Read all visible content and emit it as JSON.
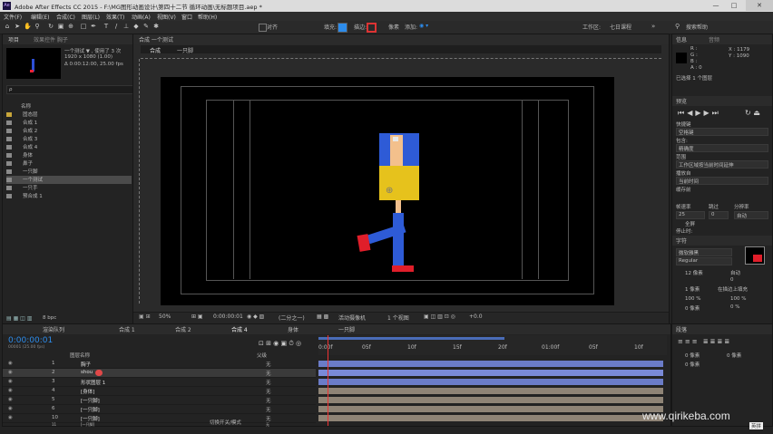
{
  "window": {
    "title": "Adobe After Effects CC 2015 - F:\\MG图形动画设计\\第四十二节 循环动画\\无标题项目.aep *",
    "minimize": "—",
    "maximize": "□",
    "close": "✕"
  },
  "menu": [
    "文件(F)",
    "编辑(E)",
    "合成(C)",
    "图层(L)",
    "效果(T)",
    "动画(A)",
    "视图(V)",
    "窗口",
    "帮助(H)"
  ],
  "toolbar": {
    "snap_label": "对齐",
    "fill_label": "填充:",
    "stroke_label": "描边:",
    "stroke_px": "像素",
    "add_label": "添加:",
    "workspace_label": "工作区:",
    "workspace_value": "七日课程",
    "search_placeholder": "搜索帮助",
    "accent": "#2d8ceb"
  },
  "project": {
    "tab": "项目",
    "effect_tab": "效果控件 胸子",
    "preview_name": "一个测试",
    "preview_info1": "一个测试 ▼ , 使用了 3 次",
    "preview_info2": "1920 x 1080 (1.00)",
    "preview_info3": "Δ 0:00:12:00, 25.00 fps",
    "search_placeholder": "ρ",
    "name_header": "名称",
    "items": [
      "固态层",
      "合成 1",
      "合成 2",
      "合成 3",
      "合成 4",
      "身体",
      "鼻子",
      "一只脚",
      "一个测试",
      "一只手",
      "预合成 1"
    ],
    "bpc": "8 bpc"
  },
  "composition": {
    "tab": "合成 一个测试",
    "breadcrumbs": [
      "合成",
      "一只脚"
    ],
    "zoom": "50%",
    "time": "0:00:00:01",
    "resolution": "(二分之一)",
    "camera": "活动摄像机",
    "views": "1 个视图",
    "exposure": "+0.0"
  },
  "info": {
    "tab1": "信息",
    "tab2": "音频",
    "r": "R :",
    "g": "G :",
    "b": "B :",
    "a": "A : 0",
    "x": "X : 1179",
    "y": "Y : 1090",
    "selected": "已选择 1 个图层"
  },
  "preview": {
    "tab": "预览",
    "shortcut_label": "快捷键",
    "shortcut_value": "空格键",
    "include_label": "包含:",
    "cache_label": "缓存前",
    "cache_value": "精确度",
    "range_label": "范围",
    "range_value": "工作区域按当前时间延伸",
    "play_from_label": "播放自",
    "play_from_value": "当前时间",
    "frame_rate_label": "帧速率",
    "skip_label": "跳过",
    "resolution_label": "分辨率",
    "frame_rate_value": "25",
    "skip_value": "0",
    "resolution_value": "自动",
    "fullscreen": "全屏",
    "stop_label": "停止时:",
    "stop_value": "如果缓存,则播放缓存的帧"
  },
  "character": {
    "tab": "字符",
    "font": "微软雅黑",
    "style": "Regular",
    "size": "12 像素",
    "leading": "自动",
    "tracking": "0",
    "stroke_px": "1 像素",
    "stroke_mode": "在描边上填充",
    "vscale": "100 %",
    "hscale": "100 %",
    "baseline": "0 像素",
    "tsume": "0 %"
  },
  "paragraph": {
    "tab": "段落",
    "indent1": "0 像素",
    "indent2": "0 像素",
    "indent3": "0 像素"
  },
  "timeline": {
    "tabs": [
      "渲染队列",
      "合成 1",
      "合成 2",
      "合成 4",
      "身体",
      "一只脚"
    ],
    "active_tab": "合成 4",
    "time": "0:00:00:01",
    "fps": "00001 (25.00 fps)",
    "col_name": "图层名称",
    "col_parent": "父级",
    "col_mode": "切换开关/模式",
    "layers": [
      {
        "num": "1",
        "name": "胸子",
        "parent": "无",
        "color": "#b3a17a"
      },
      {
        "num": "2",
        "name": "shou",
        "parent": "无",
        "color": "#b3a17a"
      },
      {
        "num": "3",
        "name": "形状图层 1",
        "parent": "无",
        "color": "#4a78c8"
      },
      {
        "num": "4",
        "name": "[身体]",
        "parent": "无",
        "color": "#b3a17a"
      },
      {
        "num": "5",
        "name": "[一只脚]",
        "parent": "无",
        "color": "#b3a17a"
      },
      {
        "num": "6",
        "name": "[一只脚]",
        "parent": "无",
        "color": "#b3a17a"
      },
      {
        "num": "10",
        "name": "[一只脚]",
        "parent": "无",
        "color": "#b3a17a"
      },
      {
        "num": "11",
        "name": "[一只脚]",
        "parent": "无",
        "color": "#b3a17a"
      }
    ],
    "ruler": [
      "0:00f",
      "05f",
      "10f",
      "15f",
      "20f",
      "01:00f",
      "05f",
      "10f"
    ]
  },
  "watermark": "www.qirikeba.com",
  "ime": "英拼"
}
